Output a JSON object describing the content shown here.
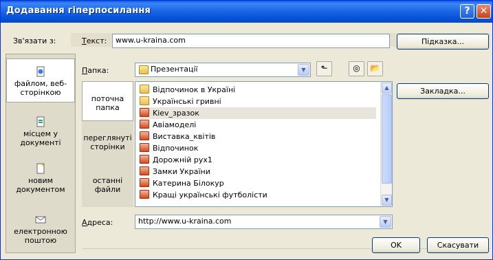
{
  "window": {
    "title": "Додавання гіперпосилання"
  },
  "link_to": {
    "label": "Зв'язати з:",
    "items": [
      {
        "label": "файлом, веб-сторінкою",
        "icon": "web-page-icon"
      },
      {
        "label": "місцем у документі",
        "icon": "document-place-icon"
      },
      {
        "label": "новим документом",
        "icon": "new-document-icon"
      },
      {
        "label": "електронною поштою",
        "icon": "email-icon"
      }
    ]
  },
  "text_field": {
    "label": "Текст:",
    "value": "www.u-kraina.com"
  },
  "hint_button": "Підказка...",
  "folder": {
    "label": "Папка:",
    "value": "Презентації"
  },
  "bookmark_button": "Закладка...",
  "subplaces": [
    {
      "label": "поточна папка"
    },
    {
      "label": "переглянуті сторінки"
    },
    {
      "label": "останні файли"
    }
  ],
  "files": [
    {
      "name": "Відпочинок в Україні",
      "type": "folder"
    },
    {
      "name": "Українські гривні",
      "type": "folder"
    },
    {
      "name": "Kiev_зразок",
      "type": "ppt"
    },
    {
      "name": "Авіамоделі",
      "type": "ppt"
    },
    {
      "name": "Виставка_квітів",
      "type": "ppt"
    },
    {
      "name": "Відпочинок",
      "type": "ppt"
    },
    {
      "name": "Дорожній рух1",
      "type": "ppt"
    },
    {
      "name": "Замки України",
      "type": "ppt"
    },
    {
      "name": "Катерина Білокур",
      "type": "ppt"
    },
    {
      "name": "Кращі українські футболісти",
      "type": "ppt"
    }
  ],
  "address": {
    "label": "Адреса:",
    "value": "http://www.u-kraina.com"
  },
  "ok_button": "OK",
  "cancel_button": "Скасувати",
  "colors": {
    "titlebar": "#0a58e6",
    "dialog_bg": "#ece9d8"
  }
}
